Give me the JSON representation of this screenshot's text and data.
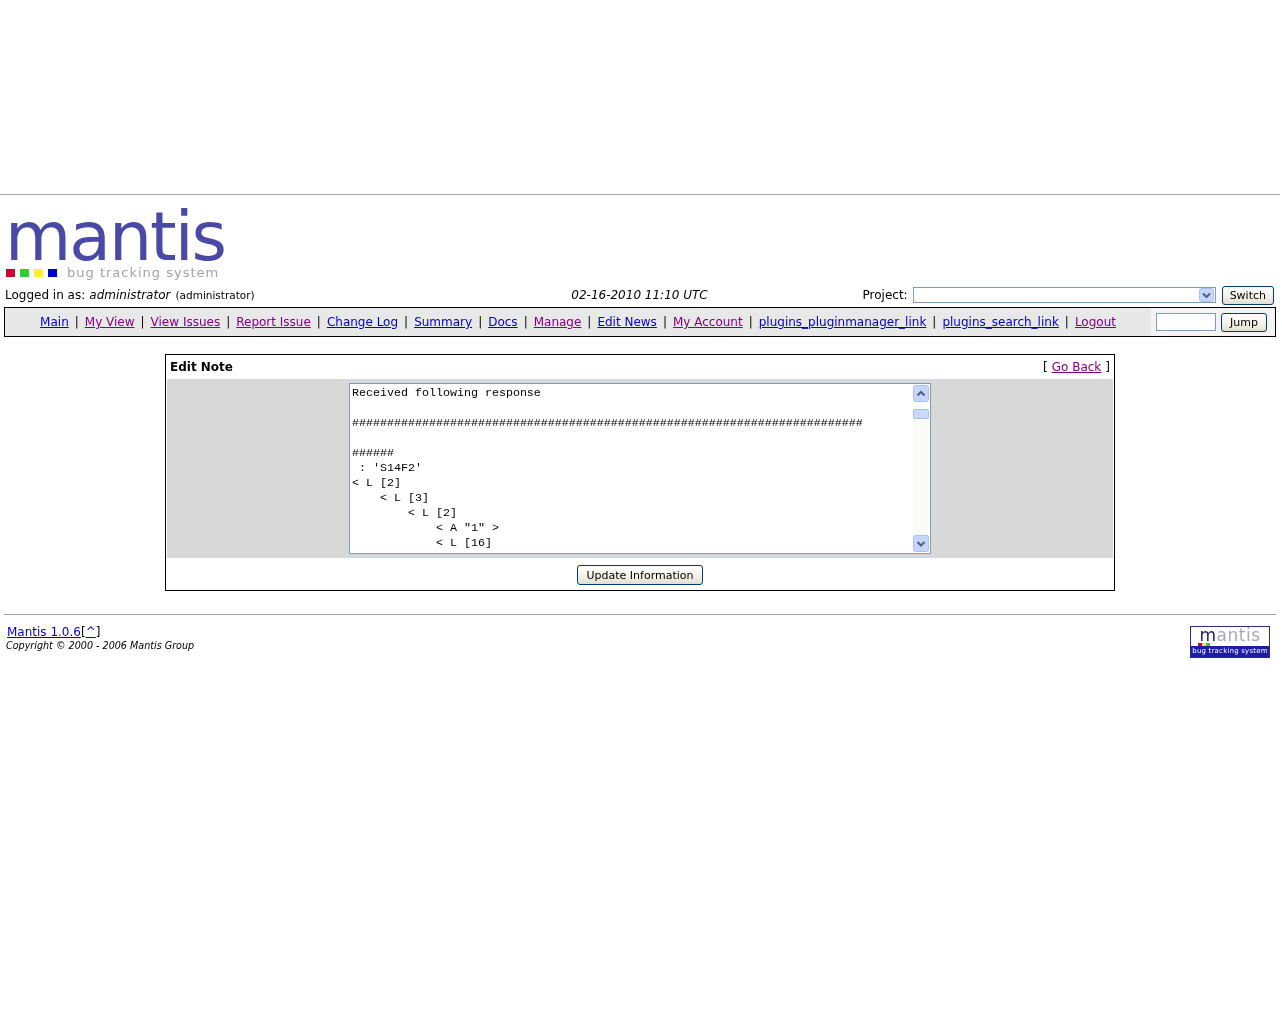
{
  "header": {
    "logo": {
      "title": "mantis",
      "tagline": "bug tracking system",
      "squares": [
        {
          "color": "#cc0033"
        },
        {
          "color": "#33cc33"
        },
        {
          "color": "#ffee33"
        },
        {
          "color": "#0000cc"
        }
      ]
    }
  },
  "session": {
    "label": "Logged in as:",
    "username": "administrator",
    "access_level": "(administrator)",
    "datetime": "02-16-2010 11:10 UTC"
  },
  "project": {
    "label": "Project:",
    "button": "Switch"
  },
  "menu": {
    "items": [
      {
        "label": "Main",
        "visited": false
      },
      {
        "separator_before": "|",
        "label": "My View",
        "visited": true
      },
      {
        "separator_before": "|",
        "label": "View Issues",
        "visited": true
      },
      {
        "separator_before": "|",
        "label": "Report Issue",
        "visited": true
      },
      {
        "separator_before": "|",
        "label": "Change Log",
        "visited": false
      },
      {
        "separator_before": "|",
        "label": "Summary",
        "visited": false
      },
      {
        "separator_before": "|",
        "label": "Docs",
        "visited": false
      },
      {
        "separator_before": "|",
        "label": "Manage",
        "visited": true
      },
      {
        "separator_before": "|",
        "label": "Edit News",
        "visited": false
      },
      {
        "separator_before": "|",
        "label": "My Account",
        "visited": true
      },
      {
        "separator_before": "|",
        "label": "plugins_pluginmanager_link",
        "visited": false
      },
      {
        "separator_before": "|",
        "label": "plugins_search_link",
        "visited": false
      },
      {
        "separator_before": "|",
        "label": "Logout",
        "visited": true
      }
    ],
    "jump_button": "Jump"
  },
  "edit_note": {
    "title": "Edit Note",
    "go_back": {
      "open": "[",
      "label": "Go Back",
      "close": "]",
      "visited": true
    },
    "note": "Received following response\n\n#########################################################################\n\n######\n : 'S14F2'\n< L [2]\n    < L [3]\n        < L [2]\n            < A \"1\" >\n            < L [16]",
    "submit": "Update Information"
  },
  "footer": {
    "version": {
      "label": "Mantis 1.0.6",
      "visited": false
    },
    "top_link": {
      "open": "[",
      "label": "^",
      "close": "]",
      "visited": false
    },
    "copyright": "Copyright © 2000 - 2006 Mantis Group",
    "logo": {
      "title": "mantis",
      "tagline": "bug tracking system"
    }
  }
}
